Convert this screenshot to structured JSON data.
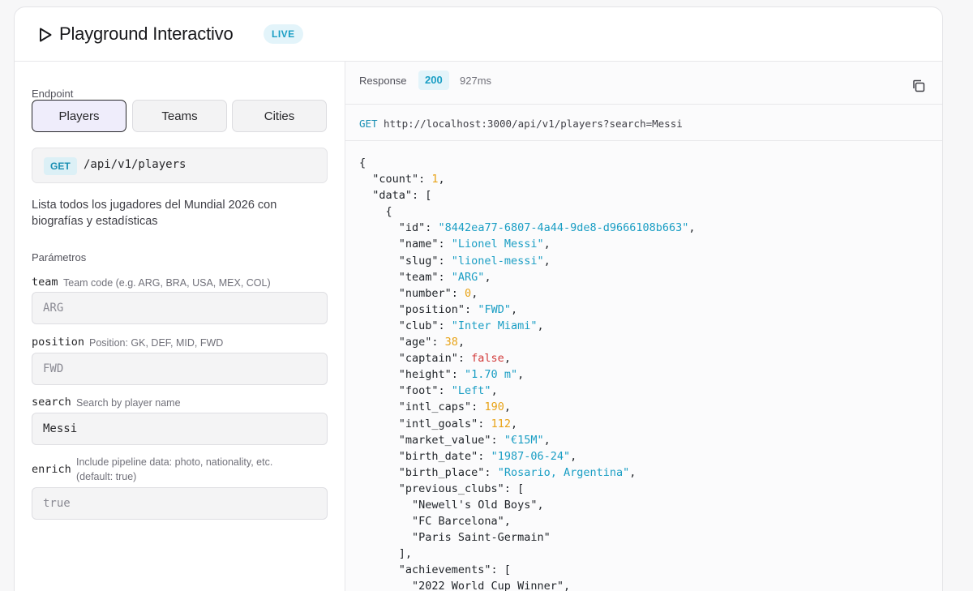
{
  "header": {
    "title": "Playground Interactivo",
    "badge": "LIVE"
  },
  "left": {
    "endpoint_label": "Endpoint",
    "endpoint_buttons": [
      "Players",
      "Teams",
      "Cities"
    ],
    "active_endpoint": "Players",
    "endpoint": {
      "method": "GET",
      "path": "/api/v1/players"
    },
    "description": "Lista todos los jugadores del Mundial 2026 con biografías y estadísticas",
    "params_label": "Parámetros",
    "params": [
      {
        "name": "team",
        "hint": "Team code (e.g. ARG, BRA, USA, MEX, COL)",
        "value": "",
        "placeholder": "ARG"
      },
      {
        "name": "position",
        "hint": "Position: GK, DEF, MID, FWD",
        "value": "",
        "placeholder": "FWD"
      },
      {
        "name": "search",
        "hint": "Search by player name",
        "value": "Messi",
        "placeholder": ""
      },
      {
        "name": "enrich",
        "hint": "Include pipeline data: photo, nationality, etc. (default: true)",
        "value": "",
        "placeholder": "true"
      }
    ]
  },
  "response": {
    "label": "Response",
    "status": "200",
    "time": "927ms",
    "request_method": "GET",
    "request_url": "http://localhost:3000/api/v1/players?search=Messi",
    "json_lines": [
      [
        [
          "p",
          "{"
        ]
      ],
      [
        [
          "p",
          "  \"count\": "
        ],
        [
          "n",
          "1"
        ],
        [
          "p",
          ","
        ]
      ],
      [
        [
          "p",
          "  \"data\": ["
        ]
      ],
      [
        [
          "p",
          "    {"
        ]
      ],
      [
        [
          "p",
          "      \"id\": "
        ],
        [
          "s",
          "\"8442ea77-6807-4a44-9de8-d9666108b663\""
        ],
        [
          "p",
          ","
        ]
      ],
      [
        [
          "p",
          "      \"name\": "
        ],
        [
          "s",
          "\"Lionel Messi\""
        ],
        [
          "p",
          ","
        ]
      ],
      [
        [
          "p",
          "      \"slug\": "
        ],
        [
          "s",
          "\"lionel-messi\""
        ],
        [
          "p",
          ","
        ]
      ],
      [
        [
          "p",
          "      \"team\": "
        ],
        [
          "s",
          "\"ARG\""
        ],
        [
          "p",
          ","
        ]
      ],
      [
        [
          "p",
          "      \"number\": "
        ],
        [
          "n",
          "0"
        ],
        [
          "p",
          ","
        ]
      ],
      [
        [
          "p",
          "      \"position\": "
        ],
        [
          "s",
          "\"FWD\""
        ],
        [
          "p",
          ","
        ]
      ],
      [
        [
          "p",
          "      \"club\": "
        ],
        [
          "s",
          "\"Inter Miami\""
        ],
        [
          "p",
          ","
        ]
      ],
      [
        [
          "p",
          "      \"age\": "
        ],
        [
          "n",
          "38"
        ],
        [
          "p",
          ","
        ]
      ],
      [
        [
          "p",
          "      \"captain\": "
        ],
        [
          "b",
          "false"
        ],
        [
          "p",
          ","
        ]
      ],
      [
        [
          "p",
          "      \"height\": "
        ],
        [
          "s",
          "\"1.70 m\""
        ],
        [
          "p",
          ","
        ]
      ],
      [
        [
          "p",
          "      \"foot\": "
        ],
        [
          "s",
          "\"Left\""
        ],
        [
          "p",
          ","
        ]
      ],
      [
        [
          "p",
          "      \"intl_caps\": "
        ],
        [
          "n",
          "190"
        ],
        [
          "p",
          ","
        ]
      ],
      [
        [
          "p",
          "      \"intl_goals\": "
        ],
        [
          "n",
          "112"
        ],
        [
          "p",
          ","
        ]
      ],
      [
        [
          "p",
          "      \"market_value\": "
        ],
        [
          "s",
          "\"€15M\""
        ],
        [
          "p",
          ","
        ]
      ],
      [
        [
          "p",
          "      \"birth_date\": "
        ],
        [
          "s",
          "\"1987-06-24\""
        ],
        [
          "p",
          ","
        ]
      ],
      [
        [
          "p",
          "      \"birth_place\": "
        ],
        [
          "s",
          "\"Rosario, Argentina\""
        ],
        [
          "p",
          ","
        ]
      ],
      [
        [
          "p",
          "      \"previous_clubs\": ["
        ]
      ],
      [
        [
          "p",
          "        \"Newell's Old Boys\","
        ]
      ],
      [
        [
          "p",
          "        \"FC Barcelona\","
        ]
      ],
      [
        [
          "p",
          "        \"Paris Saint-Germain\""
        ]
      ],
      [
        [
          "p",
          "      ],"
        ]
      ],
      [
        [
          "p",
          "      \"achievements\": ["
        ]
      ],
      [
        [
          "p",
          "        \"2022 World Cup Winner\","
        ]
      ]
    ]
  },
  "icons": {
    "play": "play-icon",
    "copy": "copy-icon"
  },
  "colors": {
    "accent": "#1a9ec4",
    "number": "#e8a317",
    "boolean": "#d23b3b"
  }
}
